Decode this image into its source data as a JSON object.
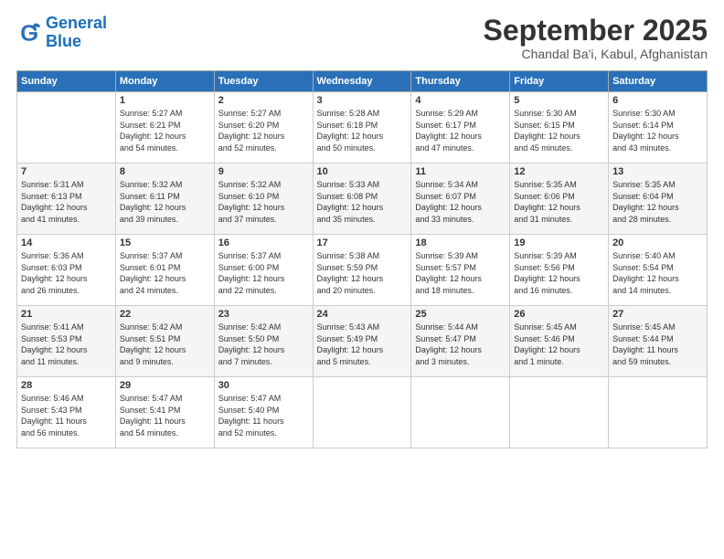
{
  "logo": {
    "line1": "General",
    "line2": "Blue"
  },
  "title": "September 2025",
  "subtitle": "Chandal Ba'i, Kabul, Afghanistan",
  "days_header": [
    "Sunday",
    "Monday",
    "Tuesday",
    "Wednesday",
    "Thursday",
    "Friday",
    "Saturday"
  ],
  "weeks": [
    [
      {
        "day": "",
        "text": ""
      },
      {
        "day": "1",
        "text": "Sunrise: 5:27 AM\nSunset: 6:21 PM\nDaylight: 12 hours\nand 54 minutes."
      },
      {
        "day": "2",
        "text": "Sunrise: 5:27 AM\nSunset: 6:20 PM\nDaylight: 12 hours\nand 52 minutes."
      },
      {
        "day": "3",
        "text": "Sunrise: 5:28 AM\nSunset: 6:18 PM\nDaylight: 12 hours\nand 50 minutes."
      },
      {
        "day": "4",
        "text": "Sunrise: 5:29 AM\nSunset: 6:17 PM\nDaylight: 12 hours\nand 47 minutes."
      },
      {
        "day": "5",
        "text": "Sunrise: 5:30 AM\nSunset: 6:15 PM\nDaylight: 12 hours\nand 45 minutes."
      },
      {
        "day": "6",
        "text": "Sunrise: 5:30 AM\nSunset: 6:14 PM\nDaylight: 12 hours\nand 43 minutes."
      }
    ],
    [
      {
        "day": "7",
        "text": "Sunrise: 5:31 AM\nSunset: 6:13 PM\nDaylight: 12 hours\nand 41 minutes."
      },
      {
        "day": "8",
        "text": "Sunrise: 5:32 AM\nSunset: 6:11 PM\nDaylight: 12 hours\nand 39 minutes."
      },
      {
        "day": "9",
        "text": "Sunrise: 5:32 AM\nSunset: 6:10 PM\nDaylight: 12 hours\nand 37 minutes."
      },
      {
        "day": "10",
        "text": "Sunrise: 5:33 AM\nSunset: 6:08 PM\nDaylight: 12 hours\nand 35 minutes."
      },
      {
        "day": "11",
        "text": "Sunrise: 5:34 AM\nSunset: 6:07 PM\nDaylight: 12 hours\nand 33 minutes."
      },
      {
        "day": "12",
        "text": "Sunrise: 5:35 AM\nSunset: 6:06 PM\nDaylight: 12 hours\nand 31 minutes."
      },
      {
        "day": "13",
        "text": "Sunrise: 5:35 AM\nSunset: 6:04 PM\nDaylight: 12 hours\nand 28 minutes."
      }
    ],
    [
      {
        "day": "14",
        "text": "Sunrise: 5:36 AM\nSunset: 6:03 PM\nDaylight: 12 hours\nand 26 minutes."
      },
      {
        "day": "15",
        "text": "Sunrise: 5:37 AM\nSunset: 6:01 PM\nDaylight: 12 hours\nand 24 minutes."
      },
      {
        "day": "16",
        "text": "Sunrise: 5:37 AM\nSunset: 6:00 PM\nDaylight: 12 hours\nand 22 minutes."
      },
      {
        "day": "17",
        "text": "Sunrise: 5:38 AM\nSunset: 5:59 PM\nDaylight: 12 hours\nand 20 minutes."
      },
      {
        "day": "18",
        "text": "Sunrise: 5:39 AM\nSunset: 5:57 PM\nDaylight: 12 hours\nand 18 minutes."
      },
      {
        "day": "19",
        "text": "Sunrise: 5:39 AM\nSunset: 5:56 PM\nDaylight: 12 hours\nand 16 minutes."
      },
      {
        "day": "20",
        "text": "Sunrise: 5:40 AM\nSunset: 5:54 PM\nDaylight: 12 hours\nand 14 minutes."
      }
    ],
    [
      {
        "day": "21",
        "text": "Sunrise: 5:41 AM\nSunset: 5:53 PM\nDaylight: 12 hours\nand 11 minutes."
      },
      {
        "day": "22",
        "text": "Sunrise: 5:42 AM\nSunset: 5:51 PM\nDaylight: 12 hours\nand 9 minutes."
      },
      {
        "day": "23",
        "text": "Sunrise: 5:42 AM\nSunset: 5:50 PM\nDaylight: 12 hours\nand 7 minutes."
      },
      {
        "day": "24",
        "text": "Sunrise: 5:43 AM\nSunset: 5:49 PM\nDaylight: 12 hours\nand 5 minutes."
      },
      {
        "day": "25",
        "text": "Sunrise: 5:44 AM\nSunset: 5:47 PM\nDaylight: 12 hours\nand 3 minutes."
      },
      {
        "day": "26",
        "text": "Sunrise: 5:45 AM\nSunset: 5:46 PM\nDaylight: 12 hours\nand 1 minute."
      },
      {
        "day": "27",
        "text": "Sunrise: 5:45 AM\nSunset: 5:44 PM\nDaylight: 11 hours\nand 59 minutes."
      }
    ],
    [
      {
        "day": "28",
        "text": "Sunrise: 5:46 AM\nSunset: 5:43 PM\nDaylight: 11 hours\nand 56 minutes."
      },
      {
        "day": "29",
        "text": "Sunrise: 5:47 AM\nSunset: 5:41 PM\nDaylight: 11 hours\nand 54 minutes."
      },
      {
        "day": "30",
        "text": "Sunrise: 5:47 AM\nSunset: 5:40 PM\nDaylight: 11 hours\nand 52 minutes."
      },
      {
        "day": "",
        "text": ""
      },
      {
        "day": "",
        "text": ""
      },
      {
        "day": "",
        "text": ""
      },
      {
        "day": "",
        "text": ""
      }
    ]
  ]
}
